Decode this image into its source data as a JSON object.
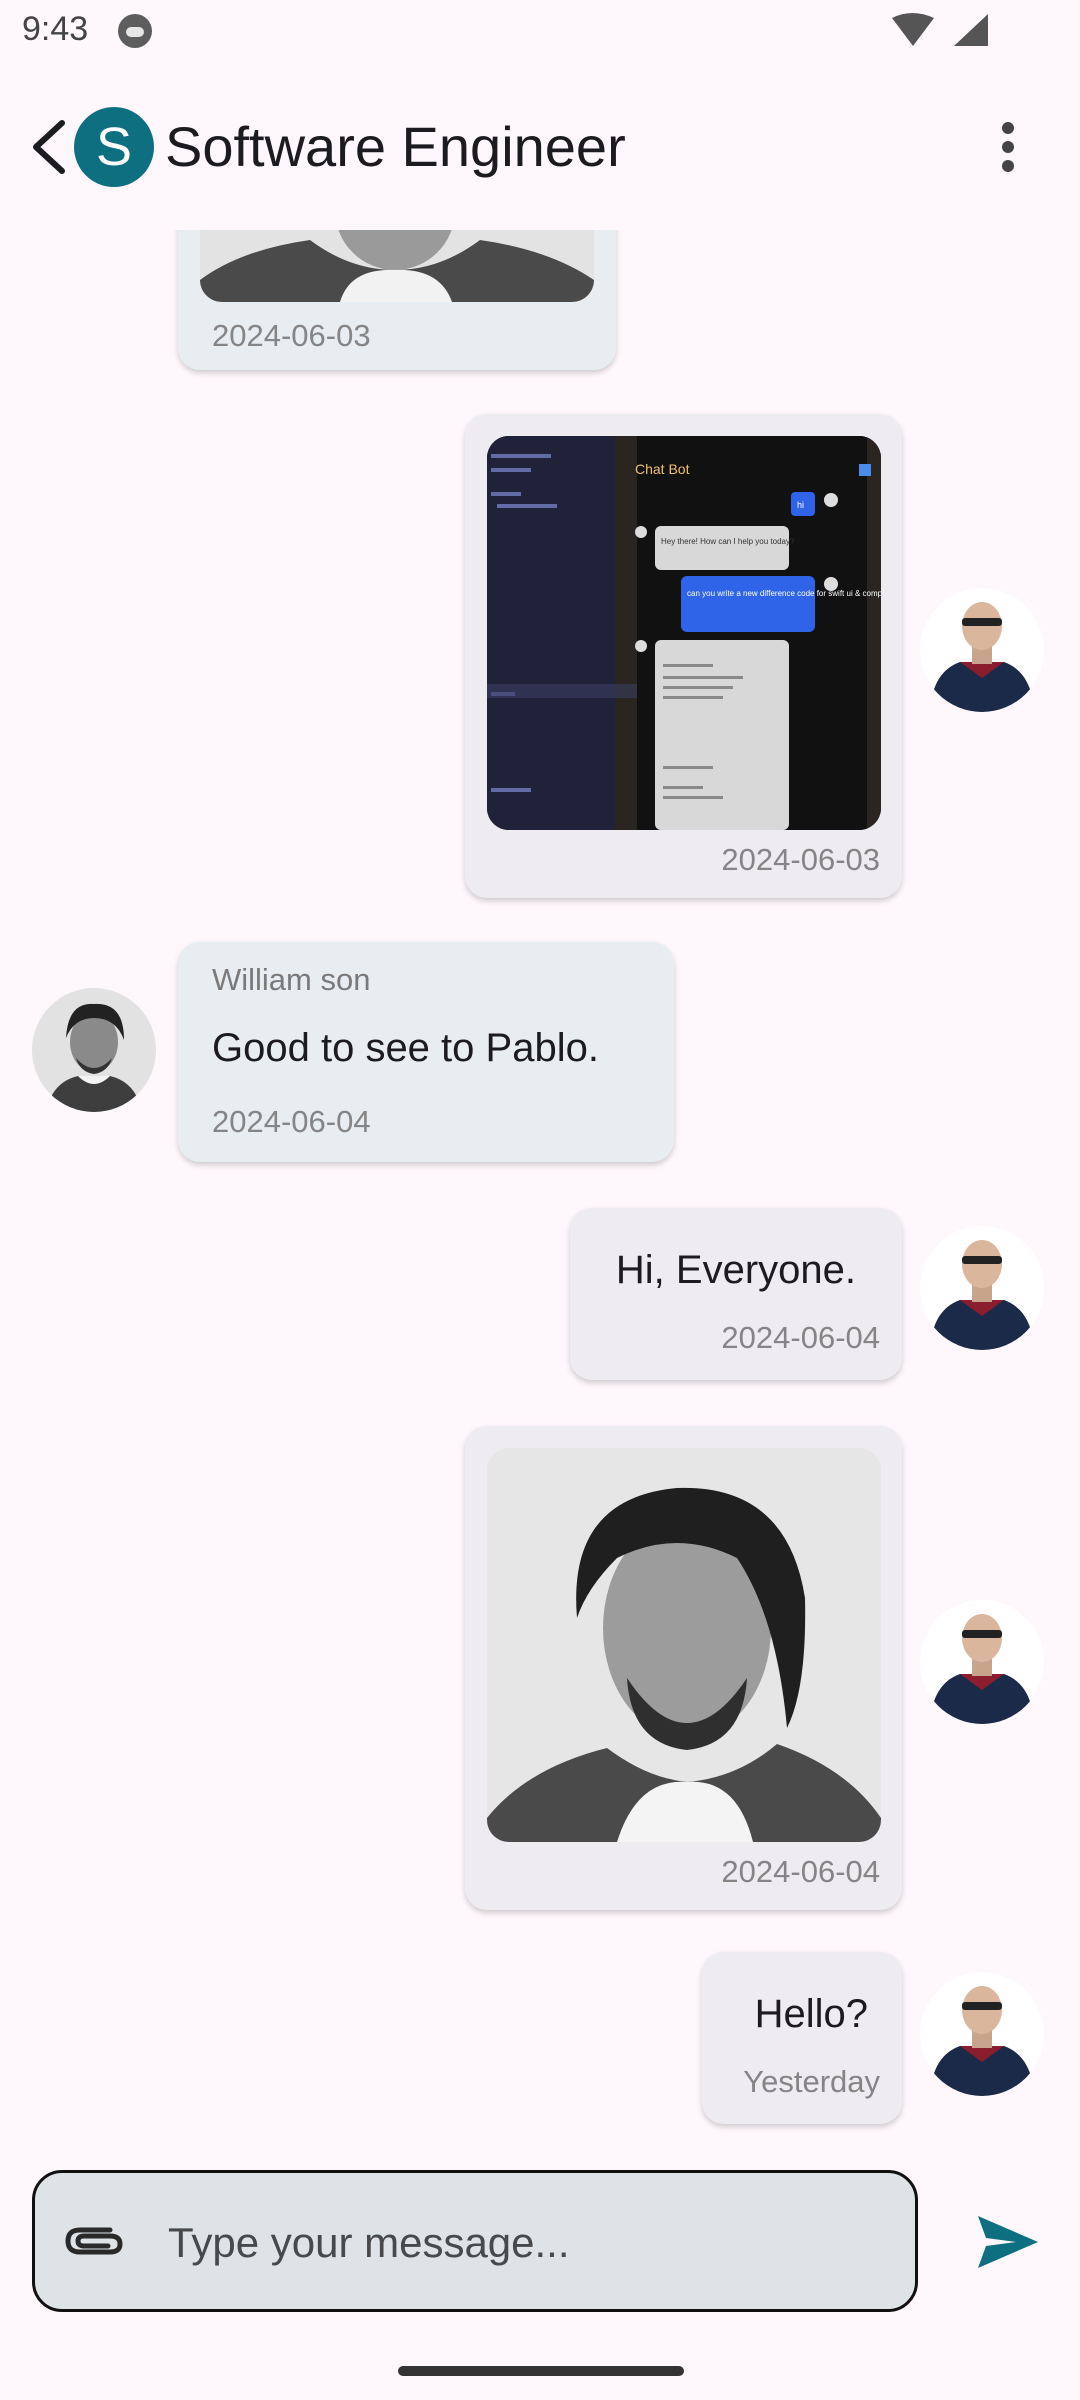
{
  "status_bar": {
    "time": "9:43"
  },
  "app_bar": {
    "avatar_letter": "S",
    "title": "Software Engineer",
    "accent": "#0E6F80"
  },
  "messages": [
    {
      "type": "image",
      "direction": "received",
      "image_desc": "person-photo",
      "timestamp": "2024-06-03"
    },
    {
      "type": "image",
      "direction": "sent",
      "image_desc": "chat-bot-screenshot",
      "timestamp": "2024-06-03",
      "screenshot": {
        "header": "Chat Bot",
        "bubble_1": "Hey there! How can I help you today?",
        "bubble_2": "can you write a new difference code for swift ui & compose ui?",
        "user_label": "hi"
      }
    },
    {
      "type": "text",
      "direction": "received",
      "sender": "William son",
      "text": "Good to see to Pablo.",
      "timestamp": "2024-06-04"
    },
    {
      "type": "text",
      "direction": "sent",
      "text": "Hi, Everyone.",
      "timestamp": "2024-06-04"
    },
    {
      "type": "image",
      "direction": "sent",
      "image_desc": "person-photo",
      "timestamp": "2024-06-04"
    },
    {
      "type": "text",
      "direction": "sent",
      "text": "Hello?",
      "timestamp": "Yesterday"
    }
  ],
  "input": {
    "placeholder": "Type your message...",
    "attach_icon": "paperclip-icon",
    "send_icon": "send-icon",
    "send_color": "#0E6F80"
  },
  "colors": {
    "background": "#FEF7FB",
    "received_bubble": "#E8EDF2",
    "sent_bubble": "#EFECF1",
    "input_background": "#DDE3E7"
  }
}
